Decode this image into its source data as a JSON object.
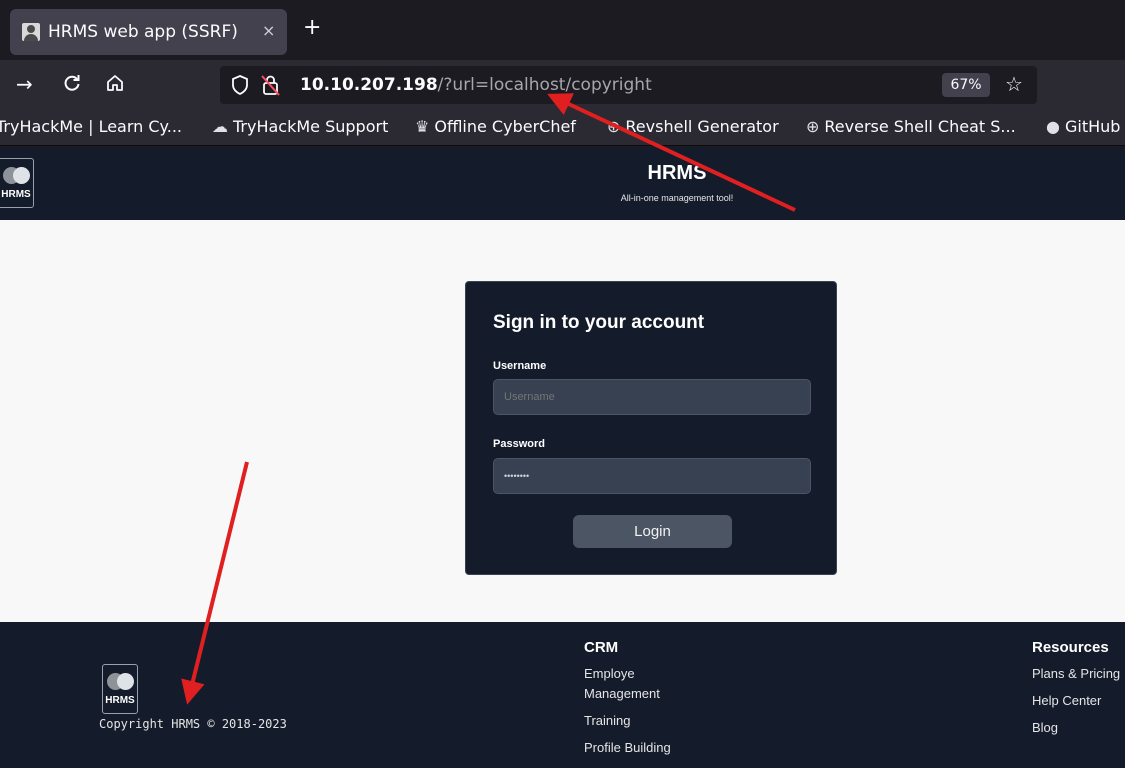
{
  "browser": {
    "tab": {
      "title": "HRMS web app (SSRF)",
      "close_glyph": "×",
      "icon": "user-icon"
    },
    "new_tab_glyph": "+",
    "nav": {
      "forward_glyph": "→",
      "reload_glyph": "C",
      "home_glyph": "⌂",
      "shield_icon": "shield-icon",
      "lock_icon": "insecure-lock-icon"
    },
    "url": {
      "host": "10.10.207.198",
      "rest": "/?url=localhost/copyright"
    },
    "zoom": "67%",
    "star_glyph": "☆",
    "bookmarks": [
      {
        "label": "TryHackMe | Learn Cy...",
        "icon": ""
      },
      {
        "label": "TryHackMe Support",
        "icon": "☁"
      },
      {
        "label": "Offline CyberChef",
        "icon": "♛"
      },
      {
        "label": "Revshell Generator",
        "icon": "⊕"
      },
      {
        "label": "Reverse Shell Cheat S...",
        "icon": "⊕"
      },
      {
        "label": "GitHub",
        "icon": "●"
      }
    ]
  },
  "site": {
    "logo_text": "HRMS",
    "title": "HRMS",
    "tagline": "All-in-one management tool!",
    "login": {
      "heading": "Sign in to your account",
      "username_label": "Username",
      "username_placeholder": "Username",
      "password_label": "Password",
      "password_value": "••••••••",
      "button": "Login"
    },
    "footer": {
      "copyright": "Copyright HRMS © 2018-2023",
      "crm": {
        "title": "CRM",
        "links": [
          "Employe",
          "Management",
          "Training",
          "Profile Building"
        ]
      },
      "resources": {
        "title": "Resources",
        "links": [
          "Plans & Pricing",
          "Help Center",
          "Blog"
        ]
      }
    }
  },
  "colors": {
    "annotation_arrow": "#e02020",
    "site_dark": "#141b2b",
    "page_bg": "#f8f8f8"
  }
}
